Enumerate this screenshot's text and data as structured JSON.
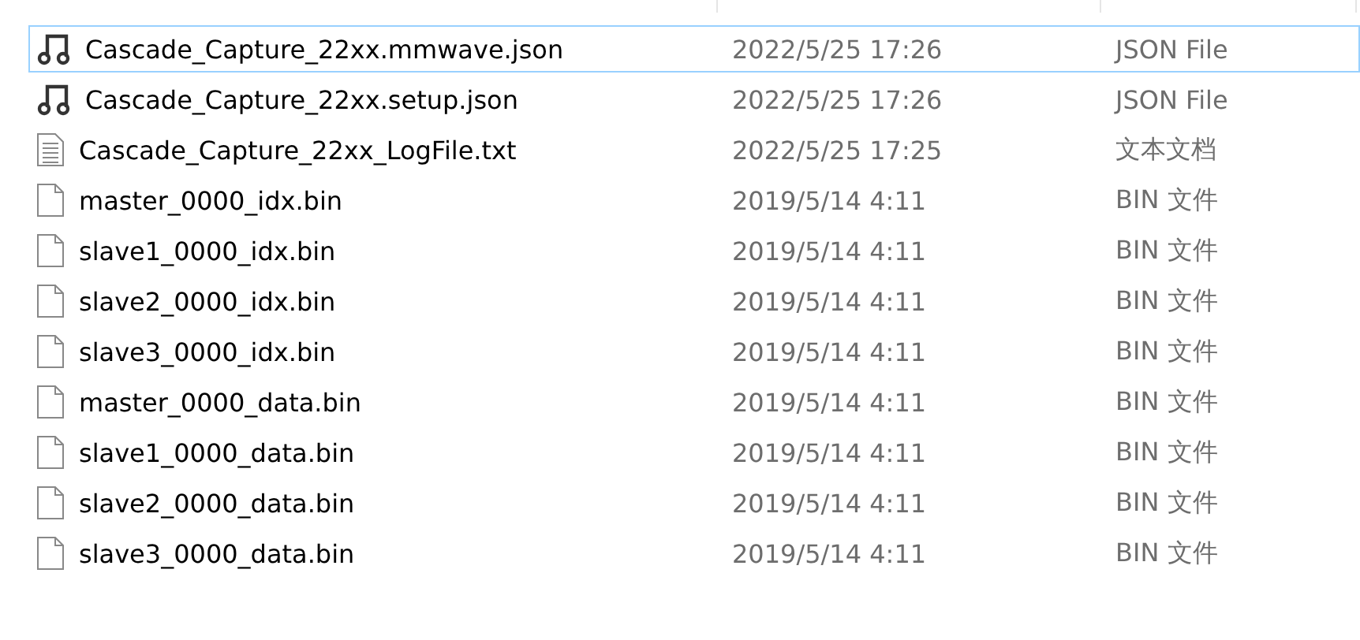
{
  "files": [
    {
      "kind": "app",
      "name": "Cascade_Capture_22xx.mmwave.json",
      "date": "2022/5/25 17:26",
      "type": "JSON File",
      "focused": true
    },
    {
      "kind": "app",
      "name": "Cascade_Capture_22xx.setup.json",
      "date": "2022/5/25 17:26",
      "type": "JSON File",
      "focused": false
    },
    {
      "kind": "text",
      "name": "Cascade_Capture_22xx_LogFile.txt",
      "date": "2022/5/25 17:25",
      "type": "文本文档",
      "focused": false
    },
    {
      "kind": "blank",
      "name": "master_0000_idx.bin",
      "date": "2019/5/14 4:11",
      "type": "BIN 文件",
      "focused": false
    },
    {
      "kind": "blank",
      "name": "slave1_0000_idx.bin",
      "date": "2019/5/14 4:11",
      "type": "BIN 文件",
      "focused": false
    },
    {
      "kind": "blank",
      "name": "slave2_0000_idx.bin",
      "date": "2019/5/14 4:11",
      "type": "BIN 文件",
      "focused": false
    },
    {
      "kind": "blank",
      "name": "slave3_0000_idx.bin",
      "date": "2019/5/14 4:11",
      "type": "BIN 文件",
      "focused": false
    },
    {
      "kind": "blank",
      "name": "master_0000_data.bin",
      "date": "2019/5/14 4:11",
      "type": "BIN 文件",
      "focused": false
    },
    {
      "kind": "blank",
      "name": "slave1_0000_data.bin",
      "date": "2019/5/14 4:11",
      "type": "BIN 文件",
      "focused": false
    },
    {
      "kind": "blank",
      "name": "slave2_0000_data.bin",
      "date": "2019/5/14 4:11",
      "type": "BIN 文件",
      "focused": false
    },
    {
      "kind": "blank",
      "name": "slave3_0000_data.bin",
      "date": "2019/5/14 4:11",
      "type": "BIN 文件",
      "focused": false
    }
  ]
}
